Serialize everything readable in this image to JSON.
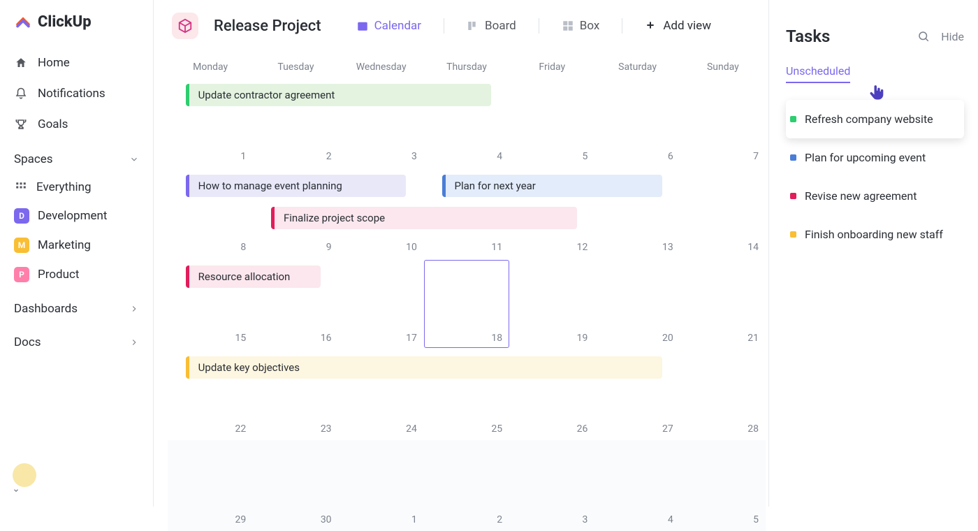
{
  "app": {
    "name": "ClickUp"
  },
  "sidebar": {
    "nav": [
      {
        "label": "Home"
      },
      {
        "label": "Notifications"
      },
      {
        "label": "Goals"
      }
    ],
    "spaces_header": "Spaces",
    "everything": "Everything",
    "spaces": [
      {
        "letter": "D",
        "color": "#7b68ee",
        "label": "Development"
      },
      {
        "letter": "M",
        "color": "#f9be34",
        "label": "Marketing"
      },
      {
        "letter": "P",
        "color": "#ff7fab",
        "label": "Product"
      }
    ],
    "dashboards": "Dashboards",
    "docs": "Docs"
  },
  "topbar": {
    "project": "Release Project",
    "views": [
      {
        "label": "Calendar",
        "active": true
      },
      {
        "label": "Board",
        "active": false
      },
      {
        "label": "Box",
        "active": false
      }
    ],
    "add_view": "Add view"
  },
  "calendar": {
    "day_headers": [
      "Monday",
      "Tuesday",
      "Wednesday",
      "Thursday",
      "Friday",
      "Saturday",
      "Sunday"
    ],
    "weeks": [
      [
        1,
        2,
        3,
        4,
        5,
        6,
        7
      ],
      [
        8,
        9,
        10,
        11,
        12,
        13,
        14
      ],
      [
        15,
        16,
        17,
        18,
        19,
        20,
        21
      ],
      [
        22,
        23,
        24,
        25,
        26,
        27,
        28
      ],
      [
        29,
        30,
        1,
        2,
        3,
        4,
        5
      ]
    ],
    "events": [
      {
        "title": "Update contractor agreement",
        "row": 0,
        "start": 0,
        "span": 4,
        "bg": "#e3f3e0",
        "bar": "#2ecd6f",
        "y": 10
      },
      {
        "title": "How to manage event planning",
        "row": 1,
        "start": 0,
        "span": 3,
        "bg": "#e8e8f9",
        "bar": "#7b68ee",
        "y": 10
      },
      {
        "title": "Plan for next year",
        "row": 1,
        "start": 3,
        "span": 3,
        "bg": "#e3ecfa",
        "bar": "#4a7dd6",
        "y": 10
      },
      {
        "title": "Finalize project scope",
        "row": 1,
        "start": 1,
        "span": 4,
        "bg": "#fbe7ed",
        "bar": "#e11d5b",
        "y": 56
      },
      {
        "title": "Resource allocation",
        "row": 2,
        "start": 0,
        "span": 2,
        "bg": "#fbe7ed",
        "bar": "#e11d5b",
        "y": 10
      },
      {
        "title": "Update key objectives",
        "row": 3,
        "start": 0,
        "span": 6,
        "bg": "#fdf6e0",
        "bar": "#f9be34",
        "y": 10
      }
    ]
  },
  "tasks": {
    "title": "Tasks",
    "hide": "Hide",
    "tab": "Unscheduled",
    "items": [
      {
        "color": "#2ecd6f",
        "label": "Refresh company website"
      },
      {
        "color": "#4a7dd6",
        "label": "Plan for upcoming event"
      },
      {
        "color": "#e11d5b",
        "label": "Revise new agreement"
      },
      {
        "color": "#f9be34",
        "label": "Finish onboarding new staff"
      }
    ]
  }
}
